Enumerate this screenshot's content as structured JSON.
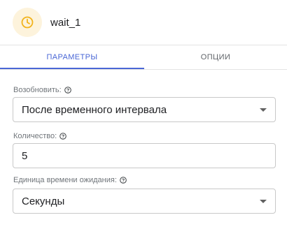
{
  "node": {
    "title": "wait_1",
    "icon": "clock-icon",
    "icon_color": "#f2b31c"
  },
  "tabs": [
    {
      "label": "ПАРАМЕТРЫ",
      "active": true
    },
    {
      "label": "ОПЦИИ",
      "active": false
    }
  ],
  "accent_color": "#4a67d6",
  "fields": {
    "resume": {
      "label": "Возобновить:",
      "value": "После временного интервала"
    },
    "quantity": {
      "label": "Количество:",
      "value": "5"
    },
    "unit": {
      "label": "Единица времени ожидания:",
      "value": "Секунды"
    }
  }
}
